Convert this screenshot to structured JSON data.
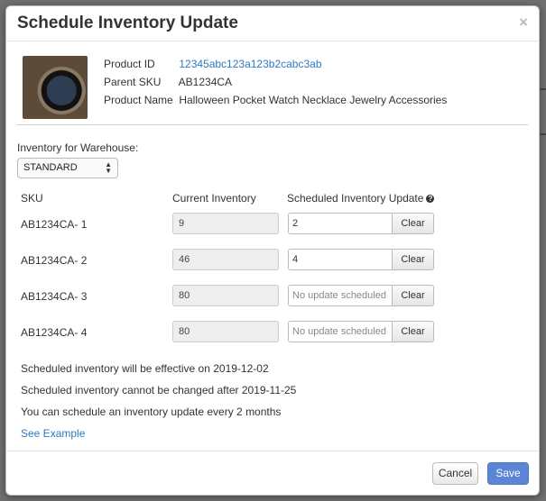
{
  "modal": {
    "title": "Schedule Inventory Update",
    "close_glyph": "×"
  },
  "product": {
    "image_alt": "pocket-watch-photo",
    "id_label": "Product ID",
    "id_value": "12345abc123a123b2cabc3ab",
    "parent_sku_label": "Parent SKU",
    "parent_sku_value": "AB1234CA",
    "name_label": "Product Name",
    "name_value": "Halloween Pocket Watch Necklace Jewelry Accessories"
  },
  "warehouse": {
    "label": "Inventory for Warehouse:",
    "selected": "STANDARD"
  },
  "table": {
    "headers": {
      "sku": "SKU",
      "current": "Current Inventory",
      "scheduled": "Scheduled Inventory Update"
    },
    "clear_label": "Clear",
    "rows": [
      {
        "sku": "AB1234CA- 1",
        "current": "9",
        "scheduled": "2",
        "placeholder": ""
      },
      {
        "sku": "AB1234CA- 2",
        "current": "46",
        "scheduled": "4",
        "placeholder": ""
      },
      {
        "sku": "AB1234CA- 3",
        "current": "80",
        "scheduled": "",
        "placeholder": "No update scheduled"
      },
      {
        "sku": "AB1234CA- 4",
        "current": "80",
        "scheduled": "",
        "placeholder": "No update scheduled"
      }
    ]
  },
  "notes": {
    "effective": "Scheduled inventory will be effective on 2019-12-02",
    "locked": "Scheduled inventory cannot be changed after 2019-11-25",
    "frequency": "You can schedule an inventory update every 2 months",
    "example_link": "See Example"
  },
  "footer": {
    "cancel_label": "Cancel",
    "save_label": "Save"
  },
  "colors": {
    "link": "#2a7bc4",
    "save_button": "#5b86d6"
  }
}
